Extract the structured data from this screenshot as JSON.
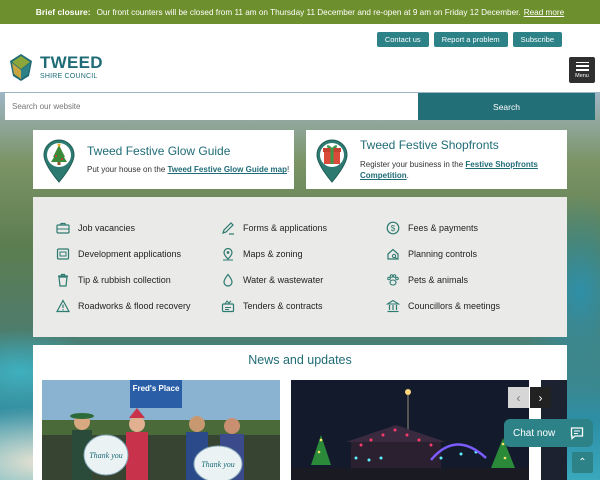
{
  "alert": {
    "label": "Brief closure:",
    "text": "Our front counters will be closed from 11 am on Thursday 11 December and re-open at 9 am on Friday 12 December.",
    "link": "Read more"
  },
  "header": {
    "links": [
      "Contact us",
      "Report a problem",
      "Subscribe"
    ],
    "logo_title": "TWEED",
    "logo_sub": "SHIRE COUNCIL",
    "menu_label": "Menu"
  },
  "search": {
    "placeholder": "Search our website",
    "button": "Search"
  },
  "promos": [
    {
      "title": "Tweed Festive Glow Guide",
      "text_before": "Put your house on the",
      "link": "Tweed Festive Glow Guide map",
      "text_after": "!"
    },
    {
      "title": "Tweed Festive Shopfronts",
      "text_before": "Register your business in the",
      "link": "Festive Shopfronts Competition",
      "text_after": "."
    }
  ],
  "quick_links": [
    {
      "label": "Job vacancies",
      "icon": "briefcase-icon"
    },
    {
      "label": "Forms & applications",
      "icon": "pencil-icon"
    },
    {
      "label": "Fees & payments",
      "icon": "dollar-icon"
    },
    {
      "label": "Development applications",
      "icon": "building-icon"
    },
    {
      "label": "Maps & zoning",
      "icon": "map-pin-icon"
    },
    {
      "label": "Planning controls",
      "icon": "house-search-icon"
    },
    {
      "label": "Tip & rubbish collection",
      "icon": "bin-icon"
    },
    {
      "label": "Water & wastewater",
      "icon": "water-drop-icon"
    },
    {
      "label": "Pets & animals",
      "icon": "paw-icon"
    },
    {
      "label": "Roadworks & flood recovery",
      "icon": "warning-icon"
    },
    {
      "label": "Tenders & contracts",
      "icon": "contract-icon"
    },
    {
      "label": "Councillors & meetings",
      "icon": "columns-icon"
    }
  ],
  "news": {
    "title": "News and updates",
    "img1_sign": "Fred's Place",
    "thank_you_1": "Thank you",
    "thank_you_2": "Thank you"
  },
  "chat": {
    "label": "Chat now"
  },
  "colors": {
    "teal": "#236f78",
    "alert_green": "#6e8f2d",
    "panel": "#eaeae8"
  }
}
